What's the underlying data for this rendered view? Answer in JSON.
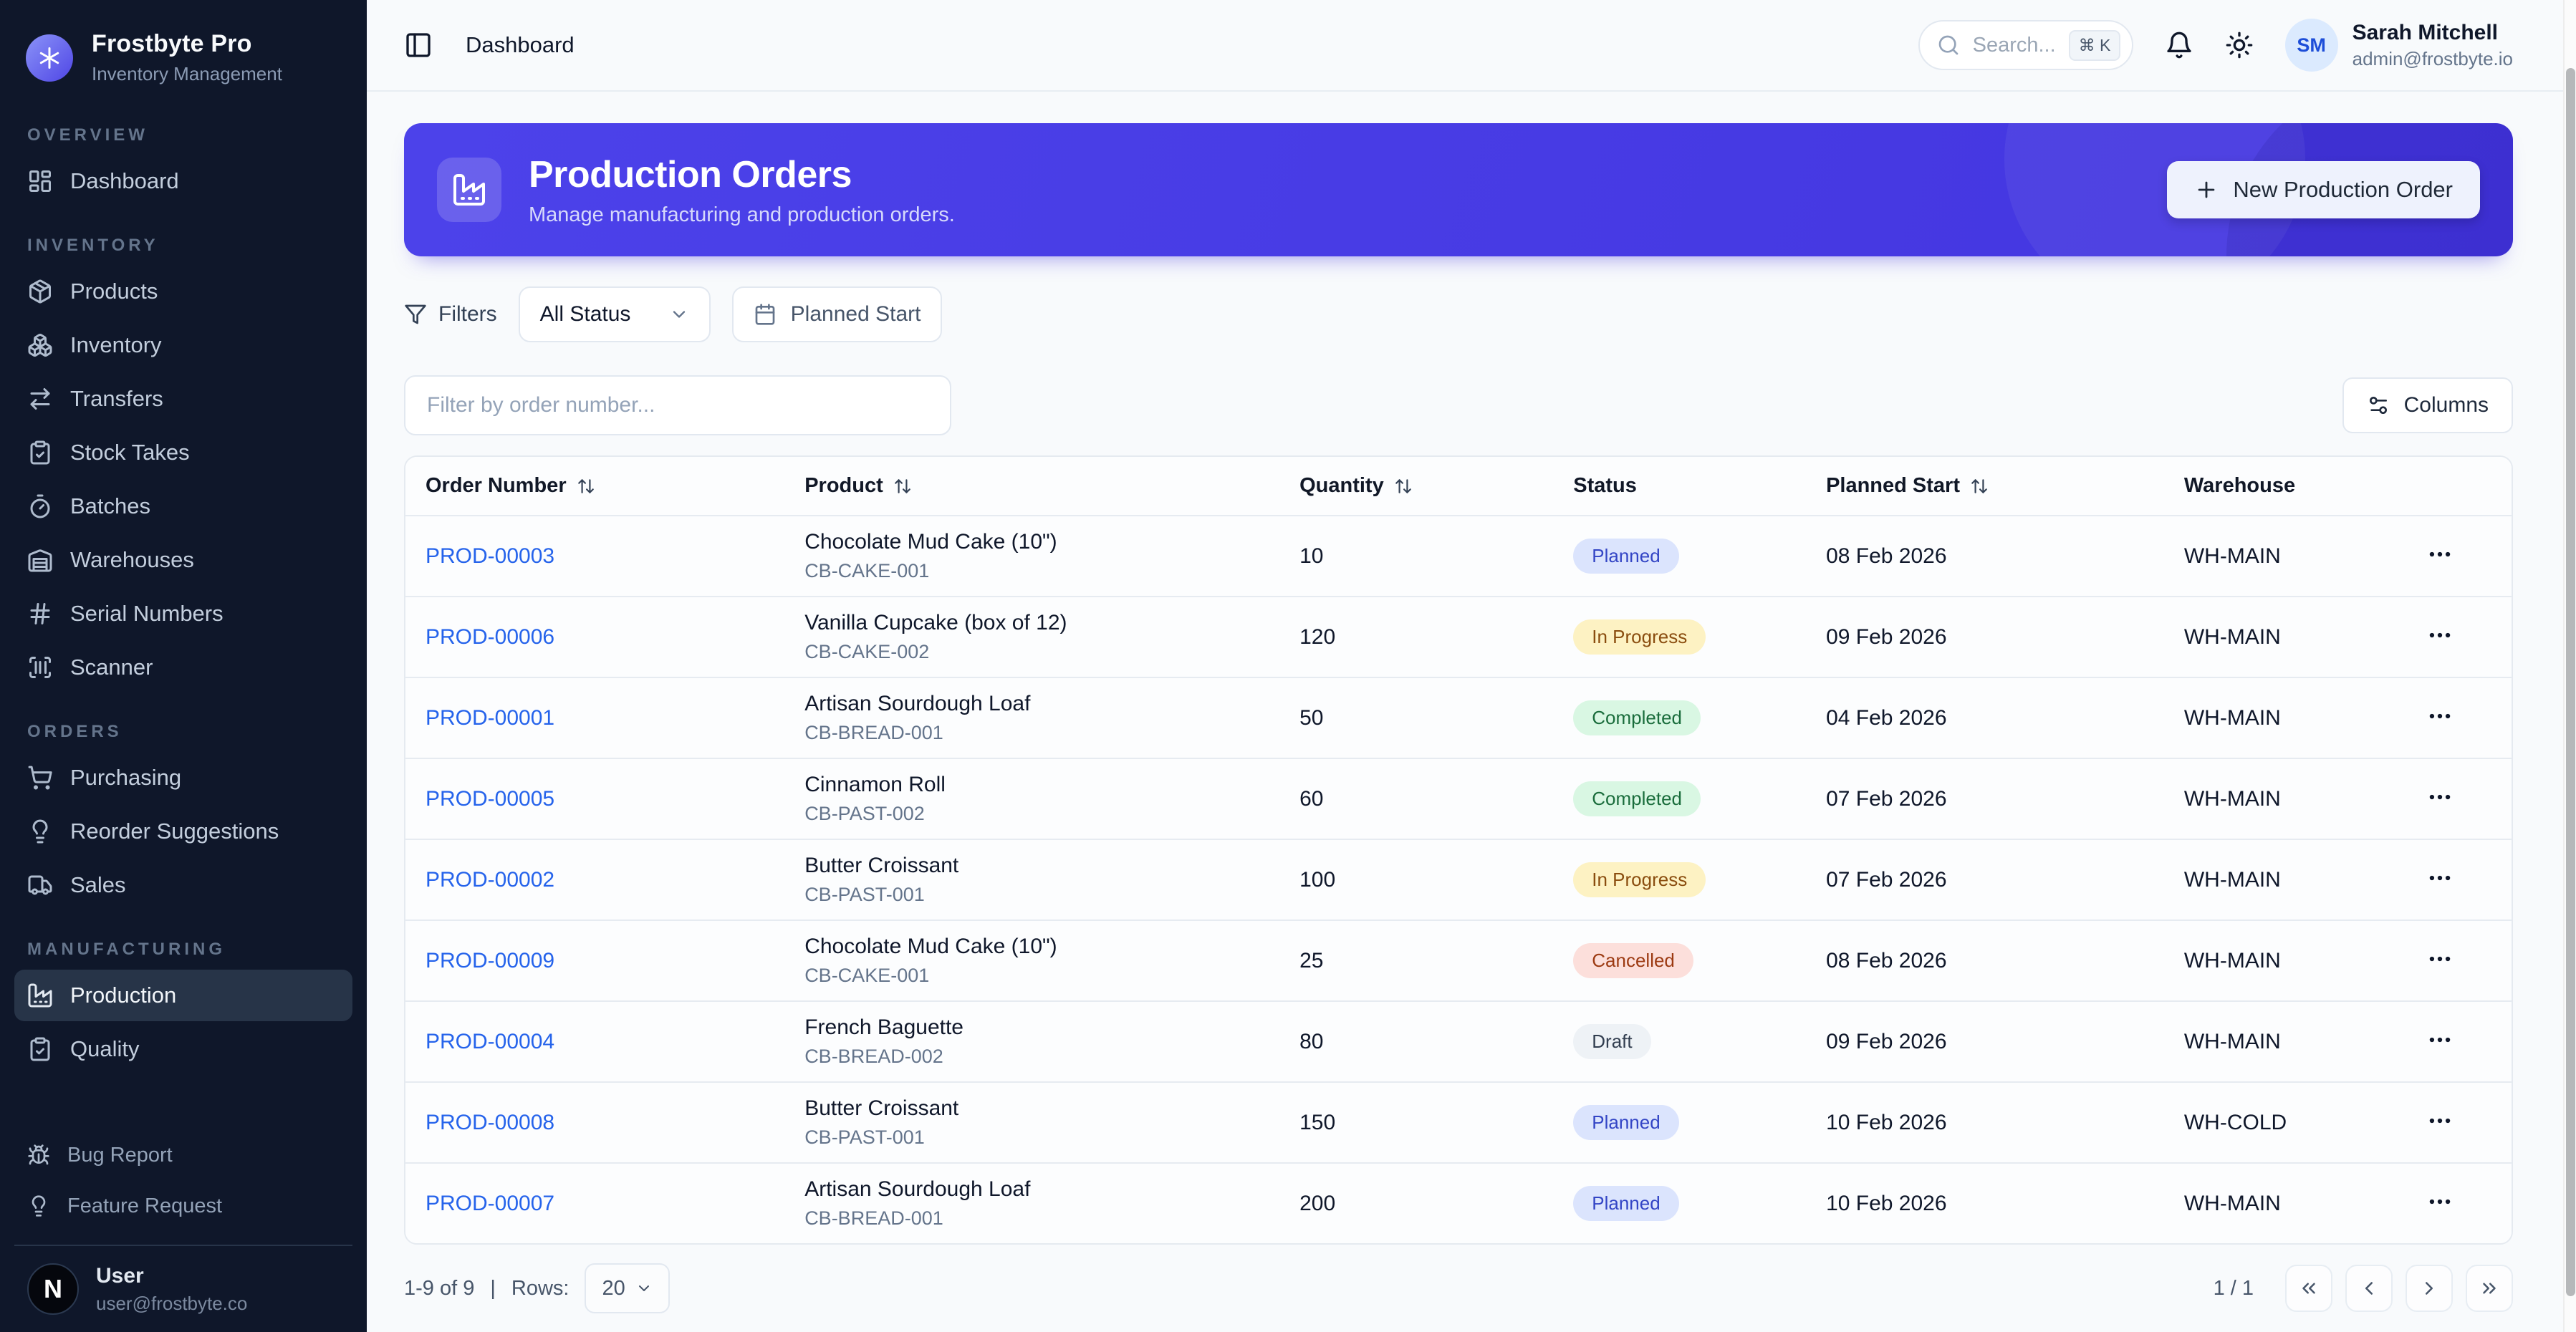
{
  "sidebar": {
    "brand": {
      "name": "Frostbyte Pro",
      "subtitle": "Inventory Management",
      "logo_icon": "asterisk"
    },
    "sections": [
      {
        "label": "OVERVIEW",
        "items": [
          {
            "label": "Dashboard",
            "icon": "dashboard",
            "active": false
          }
        ]
      },
      {
        "label": "INVENTORY",
        "items": [
          {
            "label": "Products",
            "icon": "package",
            "active": false
          },
          {
            "label": "Inventory",
            "icon": "boxes",
            "active": false
          },
          {
            "label": "Transfers",
            "icon": "transfers",
            "active": false
          },
          {
            "label": "Stock Takes",
            "icon": "clipboard-check",
            "active": false
          },
          {
            "label": "Batches",
            "icon": "timer",
            "active": false
          },
          {
            "label": "Warehouses",
            "icon": "warehouse",
            "active": false
          },
          {
            "label": "Serial Numbers",
            "icon": "hash",
            "active": false
          },
          {
            "label": "Scanner",
            "icon": "scan",
            "active": false
          }
        ]
      },
      {
        "label": "ORDERS",
        "items": [
          {
            "label": "Purchasing",
            "icon": "cart",
            "active": false
          },
          {
            "label": "Reorder Suggestions",
            "icon": "lightbulb",
            "active": false
          },
          {
            "label": "Sales",
            "icon": "truck",
            "active": false
          }
        ]
      },
      {
        "label": "MANUFACTURING",
        "items": [
          {
            "label": "Production",
            "icon": "factory",
            "active": true
          },
          {
            "label": "Quality",
            "icon": "clipboard-check",
            "active": false
          }
        ]
      }
    ],
    "footer_items": [
      {
        "label": "Bug Report",
        "icon": "bug"
      },
      {
        "label": "Feature Request",
        "icon": "lightbulb"
      }
    ],
    "user": {
      "name": "User",
      "email": "user@frostbyte.co",
      "avatar_letter": "N"
    }
  },
  "topbar": {
    "breadcrumb": "Dashboard",
    "search": {
      "placeholder": "Search...",
      "shortcut": "⌘ K"
    },
    "user": {
      "name": "Sarah Mitchell",
      "email": "admin@frostbyte.io",
      "initials": "SM"
    }
  },
  "banner": {
    "title": "Production Orders",
    "subtitle": "Manage manufacturing and production orders.",
    "button_label": "New Production Order",
    "accent_color": "#4335df"
  },
  "filters": {
    "label": "Filters",
    "status_filter_value": "All Status",
    "date_filter_label": "Planned Start"
  },
  "table_toolbar": {
    "filter_placeholder": "Filter by order number...",
    "columns_button": "Columns"
  },
  "table": {
    "columns": [
      {
        "label": "Order Number",
        "sortable": true
      },
      {
        "label": "Product",
        "sortable": true
      },
      {
        "label": "Quantity",
        "sortable": true
      },
      {
        "label": "Status",
        "sortable": false
      },
      {
        "label": "Planned Start",
        "sortable": true
      },
      {
        "label": "Warehouse",
        "sortable": false
      },
      {
        "label": "",
        "sortable": false
      }
    ],
    "status_styles": {
      "Planned": {
        "bg": "#dbe4fd",
        "text": "#3345c5"
      },
      "In Progress": {
        "bg": "#fdf2c3",
        "text": "#8a4d0f"
      },
      "Completed": {
        "bg": "#d9f7e3",
        "text": "#1a6d3c"
      },
      "Cancelled": {
        "bg": "#fcdfdb",
        "text": "#9c3a12"
      },
      "Draft": {
        "bg": "#eef2f6",
        "text": "#313d4f"
      }
    },
    "rows": [
      {
        "order": "PROD-00003",
        "product": "Chocolate Mud Cake (10\")",
        "sku": "CB-CAKE-001",
        "qty": "10",
        "status": "Planned",
        "planned_start": "08 Feb 2026",
        "warehouse": "WH-MAIN"
      },
      {
        "order": "PROD-00006",
        "product": "Vanilla Cupcake (box of 12)",
        "sku": "CB-CAKE-002",
        "qty": "120",
        "status": "In Progress",
        "planned_start": "09 Feb 2026",
        "warehouse": "WH-MAIN"
      },
      {
        "order": "PROD-00001",
        "product": "Artisan Sourdough Loaf",
        "sku": "CB-BREAD-001",
        "qty": "50",
        "status": "Completed",
        "planned_start": "04 Feb 2026",
        "warehouse": "WH-MAIN"
      },
      {
        "order": "PROD-00005",
        "product": "Cinnamon Roll",
        "sku": "CB-PAST-002",
        "qty": "60",
        "status": "Completed",
        "planned_start": "07 Feb 2026",
        "warehouse": "WH-MAIN"
      },
      {
        "order": "PROD-00002",
        "product": "Butter Croissant",
        "sku": "CB-PAST-001",
        "qty": "100",
        "status": "In Progress",
        "planned_start": "07 Feb 2026",
        "warehouse": "WH-MAIN"
      },
      {
        "order": "PROD-00009",
        "product": "Chocolate Mud Cake (10\")",
        "sku": "CB-CAKE-001",
        "qty": "25",
        "status": "Cancelled",
        "planned_start": "08 Feb 2026",
        "warehouse": "WH-MAIN"
      },
      {
        "order": "PROD-00004",
        "product": "French Baguette",
        "sku": "CB-BREAD-002",
        "qty": "80",
        "status": "Draft",
        "planned_start": "09 Feb 2026",
        "warehouse": "WH-MAIN"
      },
      {
        "order": "PROD-00008",
        "product": "Butter Croissant",
        "sku": "CB-PAST-001",
        "qty": "150",
        "status": "Planned",
        "planned_start": "10 Feb 2026",
        "warehouse": "WH-COLD"
      },
      {
        "order": "PROD-00007",
        "product": "Artisan Sourdough Loaf",
        "sku": "CB-BREAD-001",
        "qty": "200",
        "status": "Planned",
        "planned_start": "10 Feb 2026",
        "warehouse": "WH-MAIN"
      }
    ]
  },
  "pagination": {
    "range_text": "1-9 of 9",
    "separator": "|",
    "rows_label": "Rows:",
    "rows_per_page": "20",
    "page_indicator": "1 / 1"
  }
}
